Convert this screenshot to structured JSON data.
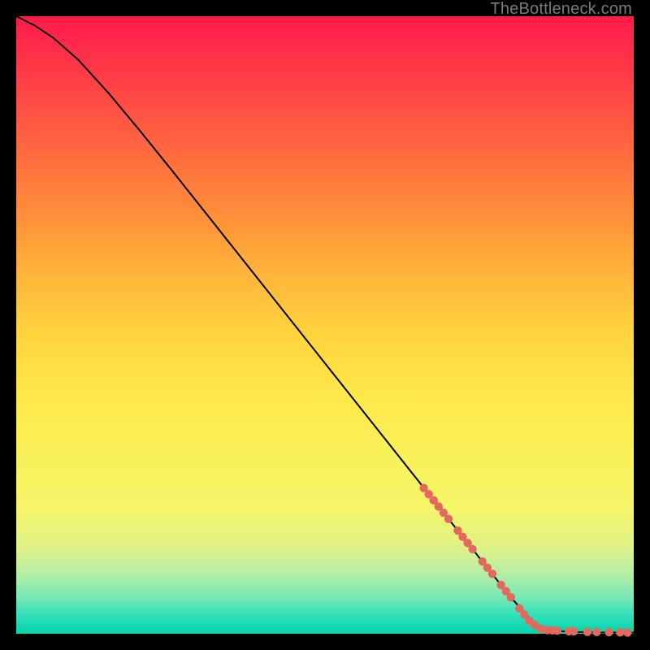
{
  "watermark": "TheBottleneck.com",
  "colors": {
    "background": "#000000",
    "curve": "#000000",
    "marker": "#e2695e",
    "gradient_top": "#ff1a4b",
    "gradient_bottom": "#0ad3a9"
  },
  "chart_data": {
    "type": "line",
    "title": "",
    "xlabel": "",
    "ylabel": "",
    "xlim": [
      0,
      100
    ],
    "ylim": [
      0,
      100
    ],
    "grid": false,
    "legend": false,
    "note": "Estimated from pixel positions; axes have no tick labels so 0-100 normalized.",
    "curve": [
      {
        "x": 0,
        "y": 100.0
      },
      {
        "x": 3,
        "y": 98.5
      },
      {
        "x": 6,
        "y": 96.5
      },
      {
        "x": 10,
        "y": 93.0
      },
      {
        "x": 15,
        "y": 87.5
      },
      {
        "x": 20,
        "y": 81.5
      },
      {
        "x": 25,
        "y": 75.3
      },
      {
        "x": 30,
        "y": 69.0
      },
      {
        "x": 35,
        "y": 62.7
      },
      {
        "x": 40,
        "y": 56.4
      },
      {
        "x": 45,
        "y": 50.1
      },
      {
        "x": 50,
        "y": 43.8
      },
      {
        "x": 55,
        "y": 37.5
      },
      {
        "x": 60,
        "y": 31.2
      },
      {
        "x": 65,
        "y": 24.9
      },
      {
        "x": 70,
        "y": 18.6
      },
      {
        "x": 75,
        "y": 12.3
      },
      {
        "x": 80,
        "y": 6.0
      },
      {
        "x": 84,
        "y": 1.5
      },
      {
        "x": 86,
        "y": 0.6
      },
      {
        "x": 90,
        "y": 0.3
      },
      {
        "x": 95,
        "y": 0.2
      },
      {
        "x": 100,
        "y": 0.2
      }
    ],
    "markers": [
      {
        "x": 66.0,
        "y": 23.6
      },
      {
        "x": 66.8,
        "y": 22.6
      },
      {
        "x": 67.6,
        "y": 21.6
      },
      {
        "x": 68.4,
        "y": 20.6
      },
      {
        "x": 69.2,
        "y": 19.6
      },
      {
        "x": 70.0,
        "y": 18.6
      },
      {
        "x": 71.5,
        "y": 16.7
      },
      {
        "x": 72.3,
        "y": 15.7
      },
      {
        "x": 73.1,
        "y": 14.7
      },
      {
        "x": 73.9,
        "y": 13.7
      },
      {
        "x": 75.5,
        "y": 11.7
      },
      {
        "x": 76.3,
        "y": 10.7
      },
      {
        "x": 77.1,
        "y": 9.7
      },
      {
        "x": 78.5,
        "y": 7.9
      },
      {
        "x": 79.3,
        "y": 6.9
      },
      {
        "x": 80.1,
        "y": 5.9
      },
      {
        "x": 81.5,
        "y": 4.1
      },
      {
        "x": 82.3,
        "y": 3.1
      },
      {
        "x": 83.1,
        "y": 2.1
      },
      {
        "x": 84.0,
        "y": 1.4
      },
      {
        "x": 85.0,
        "y": 0.8
      },
      {
        "x": 86.0,
        "y": 0.6
      },
      {
        "x": 86.8,
        "y": 0.55
      },
      {
        "x": 87.6,
        "y": 0.5
      },
      {
        "x": 89.5,
        "y": 0.4
      },
      {
        "x": 90.3,
        "y": 0.4
      },
      {
        "x": 92.5,
        "y": 0.3
      },
      {
        "x": 94.0,
        "y": 0.28
      },
      {
        "x": 96.0,
        "y": 0.25
      },
      {
        "x": 97.8,
        "y": 0.22
      },
      {
        "x": 99.0,
        "y": 0.2
      }
    ]
  }
}
